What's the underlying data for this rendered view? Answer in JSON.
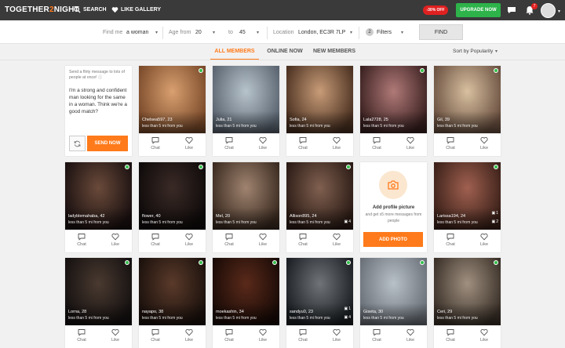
{
  "brand": {
    "logo_prefix": "TOGETHER",
    "logo_num": "2",
    "logo_suffix": "NIGHT",
    "accent": "#ff7a1a",
    "online": "#35c04a"
  },
  "topnav": {
    "search": "SEARCH",
    "like_gallery": "LIKE GALLERY",
    "offer": "-30% OFF",
    "upgrade": "UPGRADE NOW",
    "notif_count": "7"
  },
  "filters": {
    "find_me_label": "Find me",
    "find_me_value": "a woman",
    "age_from_label": "Age from",
    "age_from": "20",
    "age_to_label": "to",
    "age_to": "45",
    "location_label": "Location",
    "location_value": "London, EC3R 7LP",
    "filters_count": "2",
    "filters_label": "Filters",
    "find_button": "FIND"
  },
  "tabs": [
    {
      "label": "ALL MEMBERS",
      "active": true
    },
    {
      "label": "ONLINE NOW"
    },
    {
      "label": "NEW MEMBERS"
    }
  ],
  "sort_label": "Sort by Popularity",
  "message_card": {
    "hint": "Send a flirty message to lots of people at once!",
    "text": "I'm a strong and confident man looking for the same in a woman. Think we're a good match?",
    "send_button": "SEND NOW"
  },
  "add_photo": {
    "title": "Add profile picture",
    "subtitle": "and get x5 more messages from people",
    "button": "ADD PHOTO"
  },
  "actions": {
    "chat": "Chat",
    "like": "Like"
  },
  "profiles": [
    {
      "name": "Chelsea597, 23",
      "distance": "less than 5 mi from you",
      "online": true
    },
    {
      "name": "Julia, 21",
      "distance": "less than 5 mi from you"
    },
    {
      "name": "Sofia, 24",
      "distance": "less than 5 mi from you"
    },
    {
      "name": "Lala2728, 25",
      "distance": "less than 5 mi from you",
      "online": true
    },
    {
      "name": "Gil, 39",
      "distance": "less than 5 mi from you",
      "online": true
    },
    {
      "name": "ladyblemahaba, 42",
      "distance": "less than 5 mi from you",
      "online": true
    },
    {
      "name": "flower, 40",
      "distance": "less than 5 mi from you",
      "online": true
    },
    {
      "name": "Mel, 20",
      "distance": "less than 5 mi from you"
    },
    {
      "name": "Allison895, 24",
      "distance": "less than 5 mi from you",
      "online": true,
      "photos": "4"
    },
    {
      "name": "Larissa194, 24",
      "distance": "less than 5 mi from you",
      "online": true,
      "photos": "1",
      "photos2": "2"
    },
    {
      "name": "Lorna, 28",
      "distance": "less than 5 mi from you",
      "online": true
    },
    {
      "name": "nayapo, 38",
      "distance": "less than 5 mi from you",
      "online": true
    },
    {
      "name": "moekashin, 34",
      "distance": "less than 5 mi from you",
      "online": true
    },
    {
      "name": "sandyu0, 23",
      "distance": "less than 5 mi from you",
      "online": true,
      "photos": "1",
      "photos2": "4"
    },
    {
      "name": "Giseta, 30",
      "distance": "less than 5 mi from you",
      "online": true
    },
    {
      "name": "Ceri, 29",
      "distance": "less than 5 mi from you",
      "online": true
    }
  ]
}
